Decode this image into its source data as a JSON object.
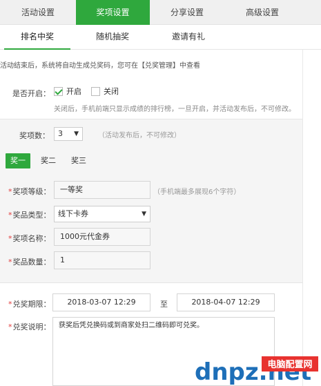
{
  "top_tabs": [
    {
      "label": "活动设置",
      "active": false
    },
    {
      "label": "奖项设置",
      "active": true
    },
    {
      "label": "分享设置",
      "active": false
    },
    {
      "label": "高级设置",
      "active": false
    }
  ],
  "sub_tabs": [
    {
      "label": "排名中奖",
      "active": true
    },
    {
      "label": "随机抽奖",
      "active": false
    },
    {
      "label": "邀请有礼",
      "active": false
    }
  ],
  "notice": "活动结束后，系统将自动生成兑奖码，您可在【兑奖管理】中查看",
  "enable": {
    "label": "是否开启：",
    "on_label": "开启",
    "off_label": "关闭",
    "on_checked": true,
    "hint": "关闭后，手机前端只显示成绩的排行榜，一旦开启，并活动发布后，不可修改。"
  },
  "prize_count": {
    "label": "奖项数：",
    "value": "3",
    "hint": "（活动发布后，不可修改）"
  },
  "prize_tabs": [
    {
      "label": "奖一",
      "active": true
    },
    {
      "label": "奖二",
      "active": false
    },
    {
      "label": "奖三",
      "active": false
    }
  ],
  "prize_form": {
    "level_label": "奖项等级：",
    "level_value": "一等奖",
    "level_hint": "（手机端最多展现6个字符）",
    "type_label": "奖品类型：",
    "type_value": "线下卡券",
    "name_label": "奖项名称：",
    "name_value": "1000元代金券",
    "qty_label": "奖品数量：",
    "qty_value": "1"
  },
  "redeem": {
    "period_label": "兑奖期限：",
    "start": "2018-03-07 12:29",
    "to": "至",
    "end": "2018-04-07 12:29",
    "desc_label": "兑奖说明：",
    "desc_value": "获奖后凭兑换码或到商家处扫二维码即可兑奖。"
  },
  "watermark": {
    "brand": "dnpz.net",
    "site_name": "电脑配置网"
  },
  "colors": {
    "accent": "#2fa83d",
    "required": "#e23c3c"
  }
}
